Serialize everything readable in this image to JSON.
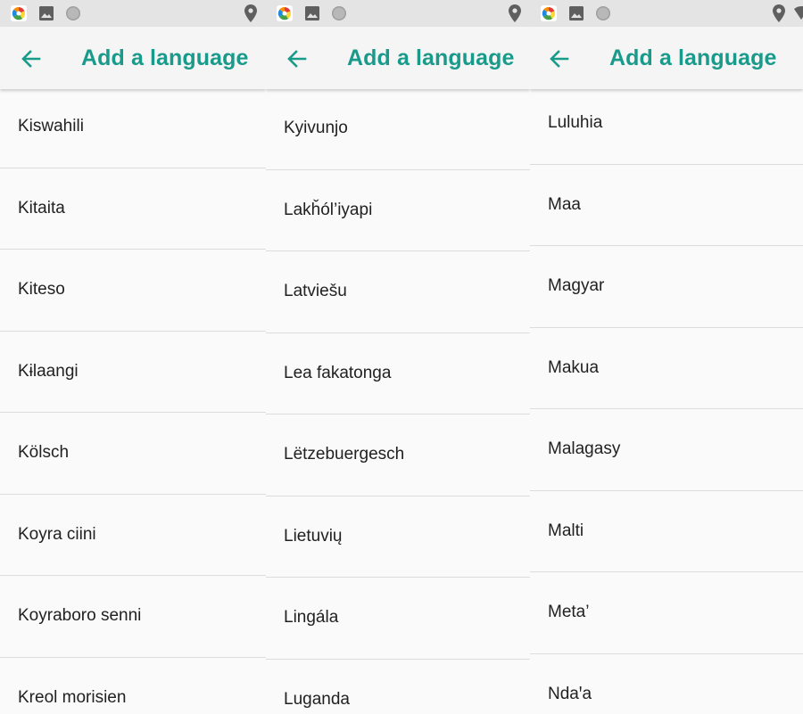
{
  "screen": {
    "title": "Add a language",
    "accent_color": "#1a9a8a",
    "back_icon": "arrow-left-icon",
    "status_icons": [
      "app-notification-icon",
      "photo-icon",
      "circle-icon",
      "location-icon",
      "wifi-icon"
    ]
  },
  "panels": [
    {
      "languages": [
        "Kiswahili",
        "Kitaita",
        "Kiteso",
        "Kɨlaangi",
        "Kölsch",
        "Koyra ciini",
        "Koyraboro senni",
        "Kreol morisien"
      ]
    },
    {
      "languages": [
        "Kyivunjo",
        "Lakȟól’iyapi",
        "Latviešu",
        "Lea fakatonga",
        "Lëtzebuergesch",
        "Lietuvių",
        "Lingála",
        "Luganda"
      ]
    },
    {
      "languages": [
        "Luluhia",
        "Maa",
        "Magyar",
        "Makua",
        "Malagasy",
        "Malti",
        "Meta’",
        "Ndaꞌa"
      ]
    }
  ]
}
